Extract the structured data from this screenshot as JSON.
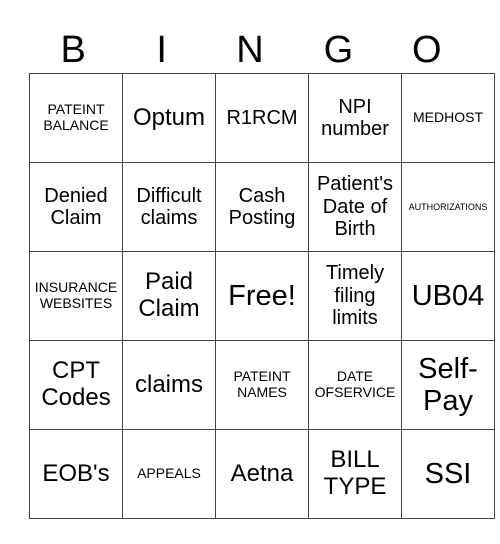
{
  "title_letters": [
    "B",
    "I",
    "N",
    "G",
    "O"
  ],
  "cells": [
    [
      {
        "text": "PATEINT BALANCE",
        "size": "sm"
      },
      {
        "text": "Optum",
        "size": "lg"
      },
      {
        "text": "R1RCM",
        "size": "md"
      },
      {
        "text": "NPI number",
        "size": "md"
      },
      {
        "text": "MEDHOST",
        "size": "sm"
      }
    ],
    [
      {
        "text": "Denied Claim",
        "size": "md"
      },
      {
        "text": "Difficult claims",
        "size": "md"
      },
      {
        "text": "Cash Posting",
        "size": "md"
      },
      {
        "text": "Patient's Date of Birth",
        "size": "md"
      },
      {
        "text": "AUTHORIZATIONS",
        "size": "xs"
      }
    ],
    [
      {
        "text": "INSURANCE WEBSITES",
        "size": "sm"
      },
      {
        "text": "Paid Claim",
        "size": "lg"
      },
      {
        "text": "Free!",
        "size": "xl"
      },
      {
        "text": "Timely filing limits",
        "size": "md"
      },
      {
        "text": "UB04",
        "size": "xl"
      }
    ],
    [
      {
        "text": "CPT Codes",
        "size": "lg"
      },
      {
        "text": "claims",
        "size": "lg"
      },
      {
        "text": "PATEINT NAMES",
        "size": "sm"
      },
      {
        "text": "DATE OFSERVICE",
        "size": "sm"
      },
      {
        "text": "Self-Pay",
        "size": "xl"
      }
    ],
    [
      {
        "text": "EOB's",
        "size": "lg"
      },
      {
        "text": "APPEALS",
        "size": "sm"
      },
      {
        "text": "Aetna",
        "size": "lg"
      },
      {
        "text": "BILL TYPE",
        "size": "lg"
      },
      {
        "text": "SSI",
        "size": "xl"
      }
    ]
  ]
}
